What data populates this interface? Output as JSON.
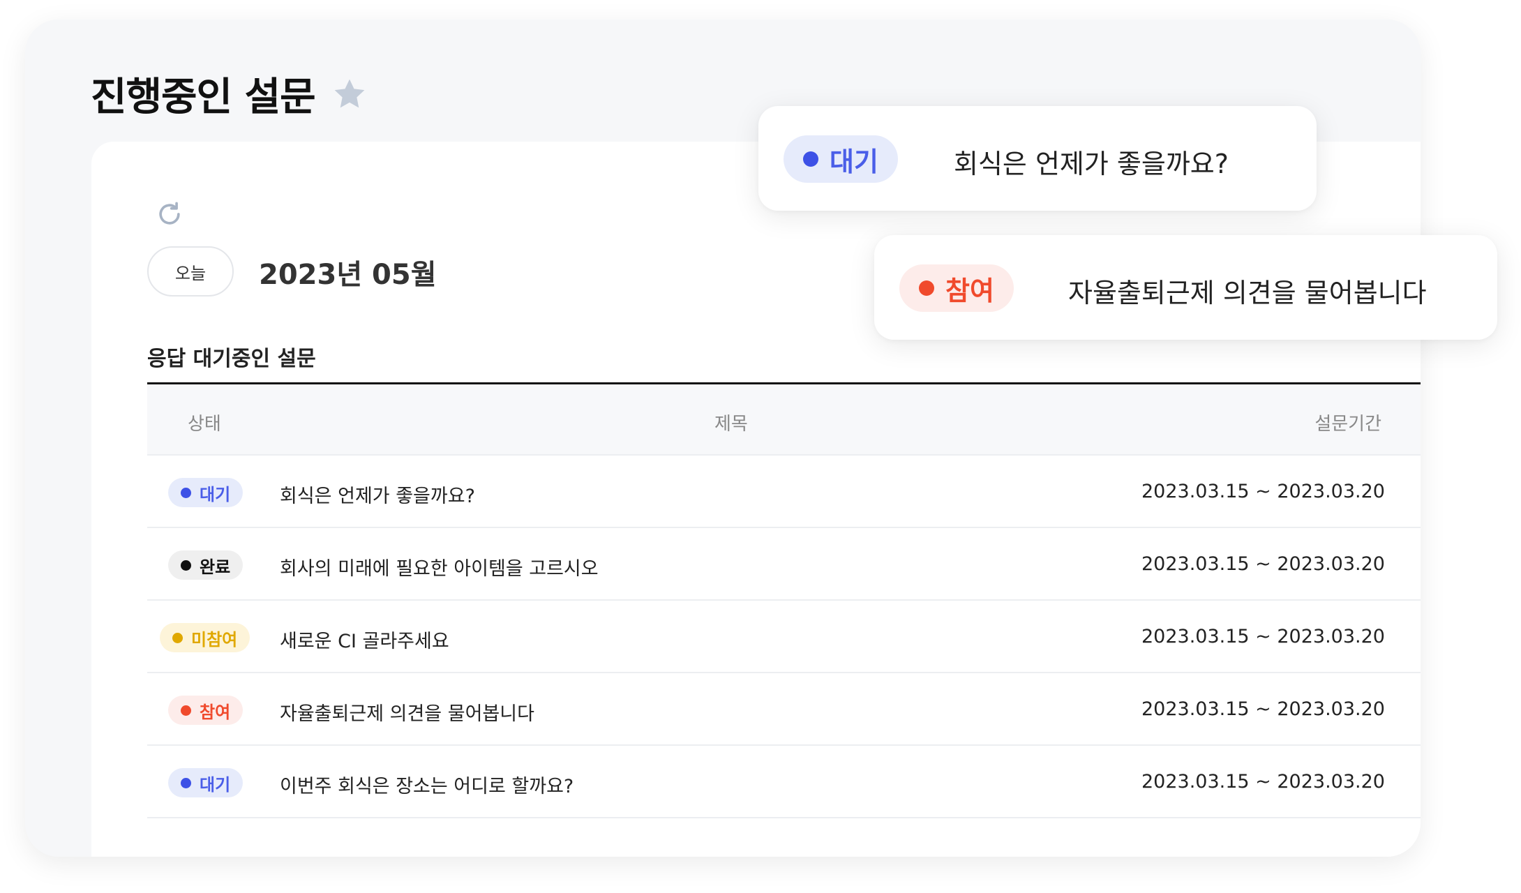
{
  "page": {
    "title": "진행중인 설문",
    "today_button": "오늘",
    "month_label": "2023년 05월",
    "section_title": "응답 대기중인 설문"
  },
  "table": {
    "headers": {
      "status": "상태",
      "title": "제목",
      "period": "설문기간"
    },
    "rows": [
      {
        "status": "대기",
        "status_type": "waiting",
        "title": "회식은 언제가 좋을까요?",
        "period": "2023.03.15 ~ 2023.03.20"
      },
      {
        "status": "완료",
        "status_type": "done",
        "title": "회사의 미래에 필요한 아이템을 고르시오",
        "period": "2023.03.15 ~ 2023.03.20"
      },
      {
        "status": "미참여",
        "status_type": "absent",
        "title": "새로운 CI 골라주세요",
        "period": "2023.03.15 ~ 2023.03.20"
      },
      {
        "status": "참여",
        "status_type": "joined",
        "title": "자율출퇴근제 의견을 물어봅니다",
        "period": "2023.03.15 ~ 2023.03.20"
      },
      {
        "status": "대기",
        "status_type": "waiting",
        "title": "이번주 회식은 장소는 어디로 할까요?",
        "period": "2023.03.15 ~ 2023.03.20"
      }
    ]
  },
  "popups": [
    {
      "status": "대기",
      "status_type": "waiting",
      "title": "회식은 언제가 좋을까요?"
    },
    {
      "status": "참여",
      "status_type": "joined",
      "title": "자율출퇴근제 의견을 물어봅니다"
    }
  ],
  "status_colors": {
    "waiting": {
      "bg": "#e6ebfb",
      "fg": "#4a5ee8",
      "dot": "#3d51e6"
    },
    "done": {
      "bg": "#efefef",
      "fg": "#111111",
      "dot": "#111111"
    },
    "absent": {
      "bg": "#fdf4d9",
      "fg": "#e0a800",
      "dot": "#e0a800"
    },
    "joined": {
      "bg": "#fdecea",
      "fg": "#f04a2c",
      "dot": "#f04a2c"
    }
  },
  "icons": {
    "favorite": "star-icon",
    "refresh": "refresh-icon"
  }
}
